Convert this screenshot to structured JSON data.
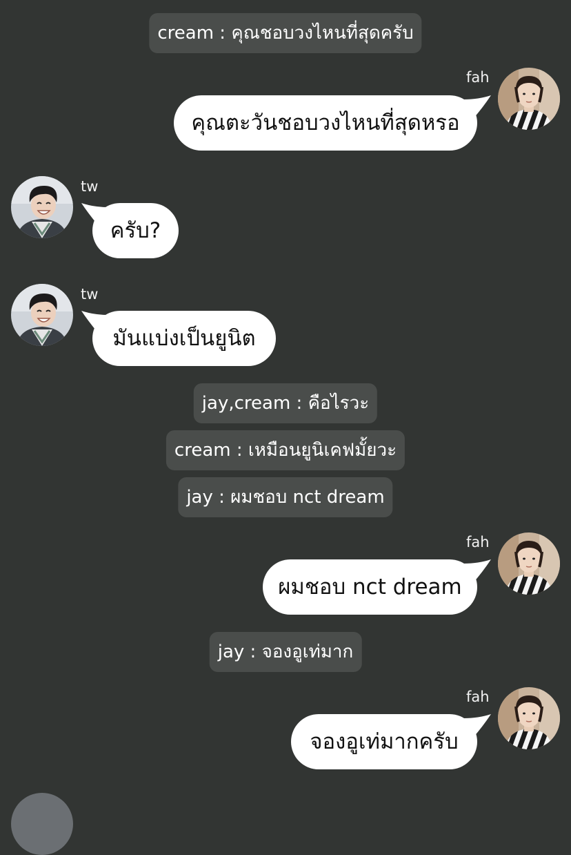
{
  "system_messages": [
    "cream : คุณชอบวงไหนที่สุดครับ",
    "jay,cream : คือไรวะ",
    "cream : เหมือนยูนิเคฟมั้ยวะ",
    "jay : ผมชอบ nct dream",
    "jay : จองอูเท่มาก"
  ],
  "messages": [
    {
      "sender": "fah",
      "text": "คุณตะวันชอบวงไหนที่สุดหรอ",
      "side": "right",
      "avatar_icon": "striped-shirt-avatar-icon"
    },
    {
      "sender": "tw",
      "text": "ครับ?",
      "side": "left",
      "avatar_icon": "smiling-avatar-icon"
    },
    {
      "sender": "tw",
      "text": "มันแบ่งเป็นยูนิต",
      "side": "left",
      "avatar_icon": "smiling-avatar-icon"
    },
    {
      "sender": "fah",
      "text": "ผมชอบ nct dream",
      "side": "right",
      "avatar_icon": "striped-shirt-avatar-icon"
    },
    {
      "sender": "fah",
      "text": "จองอูเท่มากครับ",
      "side": "right",
      "avatar_icon": "striped-shirt-avatar-icon"
    }
  ],
  "colors": {
    "background": "#323533",
    "system_bubble": "#4a4d4b",
    "chat_bubble": "#ffffff"
  }
}
